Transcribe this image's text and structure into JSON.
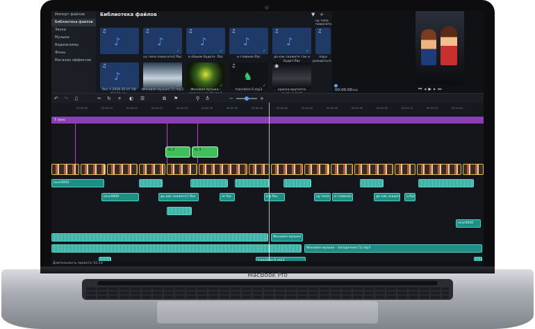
{
  "device": {
    "brand_label": "MacBook Pro"
  },
  "sidebar": {
    "items": [
      {
        "label": "Импорт файлов",
        "active": false
      },
      {
        "label": "Библиотека файлов",
        "active": true
      },
      {
        "label": "Звуки",
        "active": false
      },
      {
        "label": "Музыка",
        "active": false
      },
      {
        "label": "Видеоклипы",
        "active": false
      },
      {
        "label": "Фоны",
        "active": false
      },
      {
        "label": "Магазин эффектов",
        "active": false
      }
    ]
  },
  "library": {
    "title": "Библиотека файлов",
    "filter_icon": "filter-icon",
    "add_icon": "plus-icon",
    "row1": [
      {
        "label": "",
        "icon": "music-note-icon"
      },
      {
        "label": "ну типа помогите2.flac",
        "icon": "music-note-icon"
      },
      {
        "label": "в общем будете .flac",
        "icon": "music-note-icon"
      },
      {
        "label": "и главное.flac",
        "icon": "music-note-icon"
      },
      {
        "label": "да как скажете так и будет.flac",
        "icon": "music-note-icon"
      },
      {
        "label": "пора рождаться.flac",
        "icon": "music-note-icon"
      }
    ],
    "top_labels": [
      "ну типа помогите.flac"
    ],
    "row2": [
      {
        "label": "Rec-1-2026.02.07-18-53.14.wav",
        "icon": "music-note-icon"
      },
      {
        "label": "Фоновая музыка (1).mp3",
        "icon": "image-thumbnail"
      },
      {
        "label": "Фоновая музыка - загадочная (1).mp3",
        "icon": "image-thumbnail"
      },
      {
        "label": "transition-5.mp3",
        "icon": "music-note-icon"
      },
      {
        "label": "краска крутится пустые.mp4",
        "icon": "video-thumbnail"
      }
    ]
  },
  "preview": {
    "time": "00:00:00",
    "time_suffix": "000"
  },
  "timeline": {
    "title_track": "osvc",
    "ruler": [
      "00:00:00",
      "00:00:05",
      "00:00:10",
      "00:00:15",
      "00:00:20",
      "00:00:25",
      "00:00:30",
      "00:00:35",
      "00:00:40",
      "00:00:45",
      "00:00:50",
      "00:00:55",
      "00:01:00",
      "00:01:05",
      "00:01:10",
      "00:01:15",
      "00:01:20"
    ],
    "fx_clips": [
      "fx 2",
      "fx 3"
    ],
    "audio_labels": [
      "osvc0000",
      "да как скажете7.flac",
      "ot flac",
      "и в flac",
      "ну типа flac",
      "и главное.flac",
      "o.flac",
      "Фоновая музыка",
      "transition-5.mp3",
      "Фоновая музыка - загадочная (1).mp3"
    ]
  },
  "status_bar": {
    "text": "Длительность проекта: 01:14"
  },
  "colors": {
    "title_track": "#8a3fb8",
    "audio_clip": "#1f8f86",
    "fx_clip": "#3fbf5a",
    "accent": "#4da3ff"
  }
}
